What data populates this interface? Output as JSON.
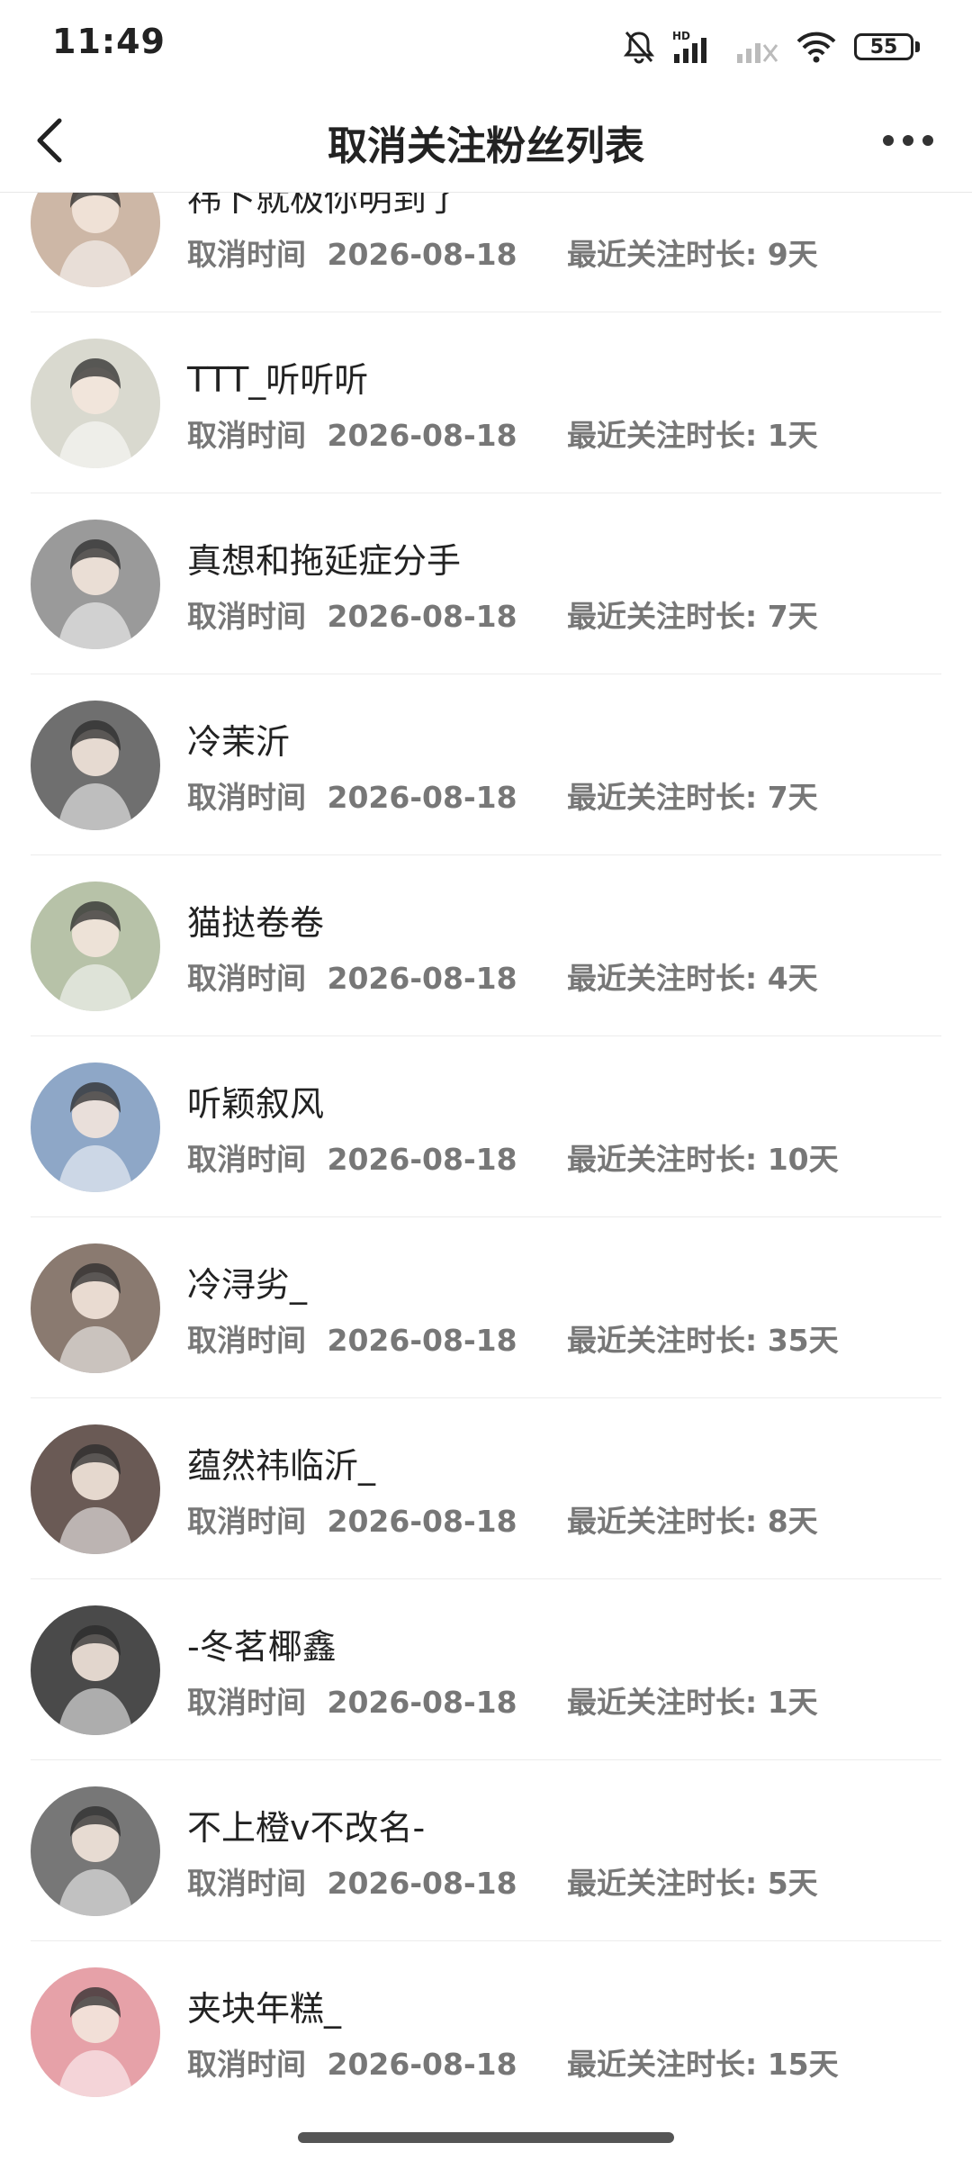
{
  "status_bar": {
    "time": "11:49",
    "battery": "55"
  },
  "header": {
    "title": "取消关注粉丝列表"
  },
  "list_labels": {
    "cancel_prefix": "取消时间",
    "duration_prefix": "最近关注时长:"
  },
  "fans": [
    {
      "name": "祎卜就极你明到了",
      "date": "2026-08-18",
      "duration": "9天",
      "avatar_color": "#cdb7a6"
    },
    {
      "name": "TTT_听听听",
      "date": "2026-08-18",
      "duration": "1天",
      "avatar_color": "#d9d9cf"
    },
    {
      "name": "真想和拖延症分手",
      "date": "2026-08-18",
      "duration": "7天",
      "avatar_color": "#9a9a9a"
    },
    {
      "name": "冷茉沂",
      "date": "2026-08-18",
      "duration": "7天",
      "avatar_color": "#6f6f6f"
    },
    {
      "name": "猫挞卷卷",
      "date": "2026-08-18",
      "duration": "4天",
      "avatar_color": "#b7c2a8"
    },
    {
      "name": "听颖叙风",
      "date": "2026-08-18",
      "duration": "10天",
      "avatar_color": "#8ea7c7"
    },
    {
      "name": "冷浔劣_",
      "date": "2026-08-18",
      "duration": "35天",
      "avatar_color": "#8a7a70"
    },
    {
      "name": "蕴然祎临沂_",
      "date": "2026-08-18",
      "duration": "8天",
      "avatar_color": "#6a5a55"
    },
    {
      "name": "-冬茗椰鑫",
      "date": "2026-08-18",
      "duration": "1天",
      "avatar_color": "#4a4a4a"
    },
    {
      "name": "不上橙v不改名-",
      "date": "2026-08-18",
      "duration": "5天",
      "avatar_color": "#777777"
    },
    {
      "name": "夹块年糕_",
      "date": "2026-08-18",
      "duration": "15天",
      "avatar_color": "#e6a1a8"
    }
  ]
}
